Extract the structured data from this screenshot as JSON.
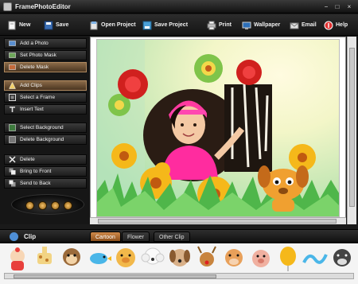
{
  "window": {
    "title": "FramePhotoEditor",
    "controls": [
      "−",
      "□",
      "×"
    ]
  },
  "toolbar": {
    "items": [
      {
        "label": "New",
        "icon": "new-document-icon"
      },
      {
        "label": "Save",
        "icon": "save-icon"
      },
      {
        "label": "Open Project",
        "icon": "open-project-icon"
      },
      {
        "label": "Save Project",
        "icon": "save-project-icon"
      },
      {
        "label": "Print",
        "icon": "printer-icon"
      },
      {
        "label": "Wallpaper",
        "icon": "wallpaper-icon"
      },
      {
        "label": "Email",
        "icon": "email-icon"
      },
      {
        "label": "Help",
        "icon": "help-icon"
      }
    ]
  },
  "sidebar": {
    "items": [
      {
        "label": "Add a Photo",
        "icon": "add-photo-icon",
        "active": false
      },
      {
        "label": "Set Photo Mask",
        "icon": "photo-mask-icon",
        "active": false
      },
      {
        "label": "Delete Mask",
        "icon": "delete-mask-icon",
        "active": true
      },
      {
        "label": "Add Clips",
        "icon": "add-clips-icon",
        "active": true
      },
      {
        "label": "Select a Frame",
        "icon": "frame-icon",
        "active": false
      },
      {
        "label": "Insert Text",
        "icon": "text-icon",
        "active": false
      },
      {
        "label": "Select Background",
        "icon": "background-icon",
        "active": false
      },
      {
        "label": "Delete Background",
        "icon": "delete-background-icon",
        "active": false
      },
      {
        "label": "Delete",
        "icon": "delete-icon",
        "active": false
      },
      {
        "label": "Bring to Front",
        "icon": "bring-front-icon",
        "active": false
      },
      {
        "label": "Send to Back",
        "icon": "send-back-icon",
        "active": false
      }
    ]
  },
  "clip_panel": {
    "label": "Clip",
    "tabs": [
      {
        "label": "Cartoon",
        "active": true
      },
      {
        "label": "Flower",
        "active": false
      },
      {
        "label": "Other Clip",
        "active": false
      }
    ],
    "thumbnails": [
      "baby-icon",
      "giraffe-icon",
      "monkey-icon",
      "bird-icon",
      "pig-icon",
      "poodle-icon",
      "puppy-icon",
      "reindeer-icon",
      "cow-icon",
      "piglet-icon",
      "balloon-icon",
      "wave-icon",
      "cow-icon"
    ]
  },
  "colors": {
    "accent": "#c47a34",
    "sidebar_active": "#8a6a48",
    "toolbar_bg": "#1e1e1e"
  }
}
